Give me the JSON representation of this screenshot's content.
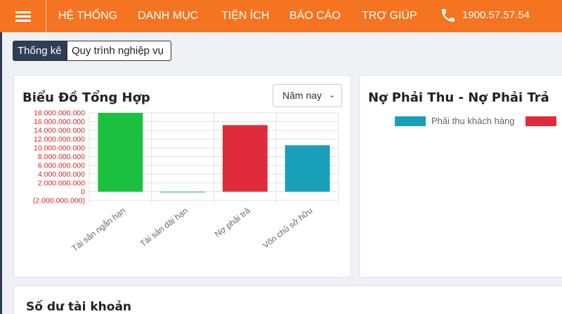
{
  "header": {
    "nav": [
      "HỆ THỐNG",
      "DANH MỤC",
      "TIỆN ÍCH",
      "BÁO CÁO",
      "TRỢ GIÚP"
    ],
    "phone": "1900.57.57.54",
    "brand_color": "#f47421"
  },
  "tabs": {
    "active": "Thống kê",
    "inactive": "Quy trình nghiệp vụ"
  },
  "summary_card": {
    "title": "Biểu Đồ Tổng Hợp",
    "period_select": "Năm nay",
    "chart_data": {
      "type": "bar",
      "categories": [
        "Tài sản ngắn hạn",
        "Tài sản dài hạn",
        "Nợ phải trả",
        "Vốn chủ sở hữu"
      ],
      "values": [
        18000000000,
        0,
        15200000000,
        10600000000
      ],
      "colors": [
        "#1cc13f",
        "#1cc13f",
        "#e02b3c",
        "#1a9fb8"
      ],
      "ylim": [
        -2000000000,
        18000000000
      ],
      "y_ticks": [
        "18.000.000.000",
        "16.000.000.000",
        "14.000.000.000",
        "12.000.000.000",
        "10.000.000.000",
        "8.000.000.000",
        "6.000.000.000",
        "4.000.000.000",
        "2.000.000.000",
        "0",
        "(2.000.000.000)"
      ],
      "grid": true
    }
  },
  "payables_card": {
    "title": "Nợ Phải Thu - Nợ Phải Trả",
    "legend": [
      {
        "label": "Phải thu khách hàng",
        "color": "#1a9fb8"
      },
      {
        "label": "",
        "color": "#e02b3c"
      }
    ]
  },
  "balance_card": {
    "title": "Số dư tài khoản"
  }
}
